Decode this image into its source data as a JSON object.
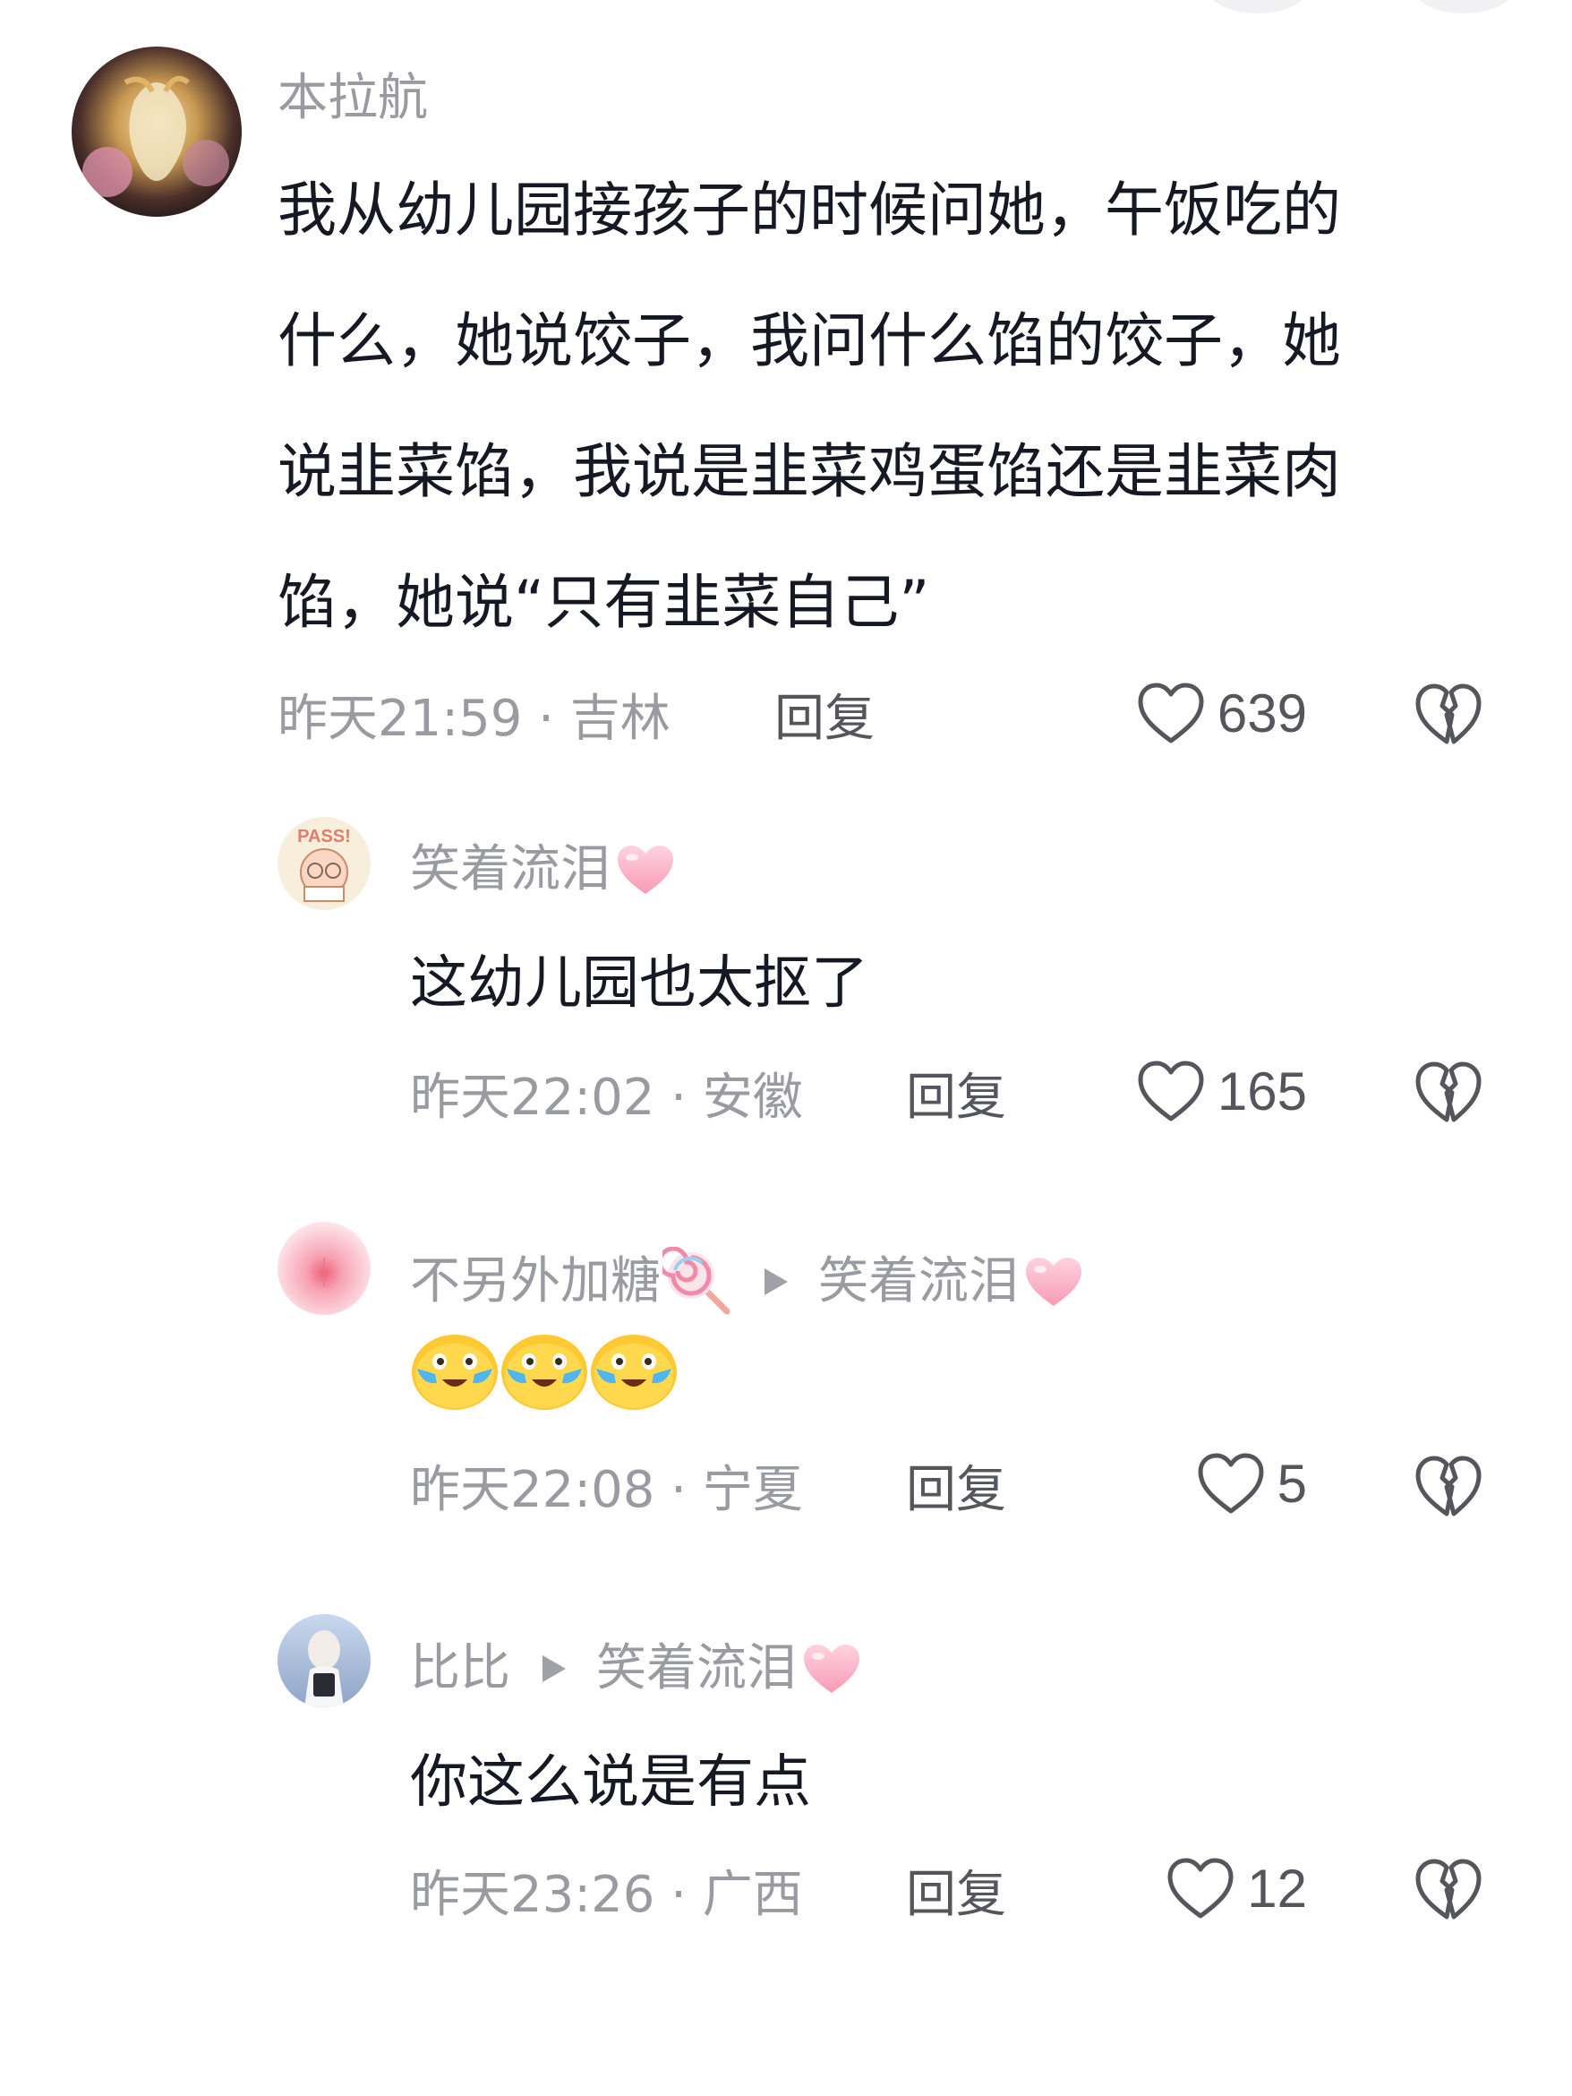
{
  "comments": [
    {
      "username": "本拉航",
      "text_lines": [
        "我从幼儿园接孩子的时候问她，午饭吃的",
        "什么，她说饺子，我问什么馅的饺子，她",
        "说韭菜馅，我说是韭菜鸡蛋馅还是韭菜肉",
        "馅，她说“只有韭菜自己”"
      ],
      "meta": "昨天21:59 · 吉林",
      "reply_label": "回复",
      "likes": "639"
    }
  ],
  "replies": [
    {
      "username": "笑着流泪",
      "text": "这幼儿园也太抠了",
      "meta": "昨天22:02 · 安徽",
      "reply_label": "回复",
      "likes": "165"
    },
    {
      "username": "不另外加糖",
      "reply_to": "笑着流泪",
      "meta": "昨天22:08 · 宁夏",
      "reply_label": "回复",
      "likes": "5"
    },
    {
      "username": "比比",
      "reply_to": "笑着流泪",
      "text": "你这么说是有点",
      "meta": "昨天23:26 · 广西",
      "reply_label": "回复",
      "likes": "12"
    }
  ],
  "icons": {
    "like": "heart-outline-icon",
    "dislike": "broken-heart-icon",
    "reply_arrow": "play-triangle-icon",
    "crying_emoji": "crying-face-emoji",
    "pink_heart": "pink-heart-emoji",
    "lollipop": "lollipop-emoji"
  },
  "colors": {
    "username": "#9a9ba1",
    "text": "#161823",
    "secondary": "#55565c"
  }
}
